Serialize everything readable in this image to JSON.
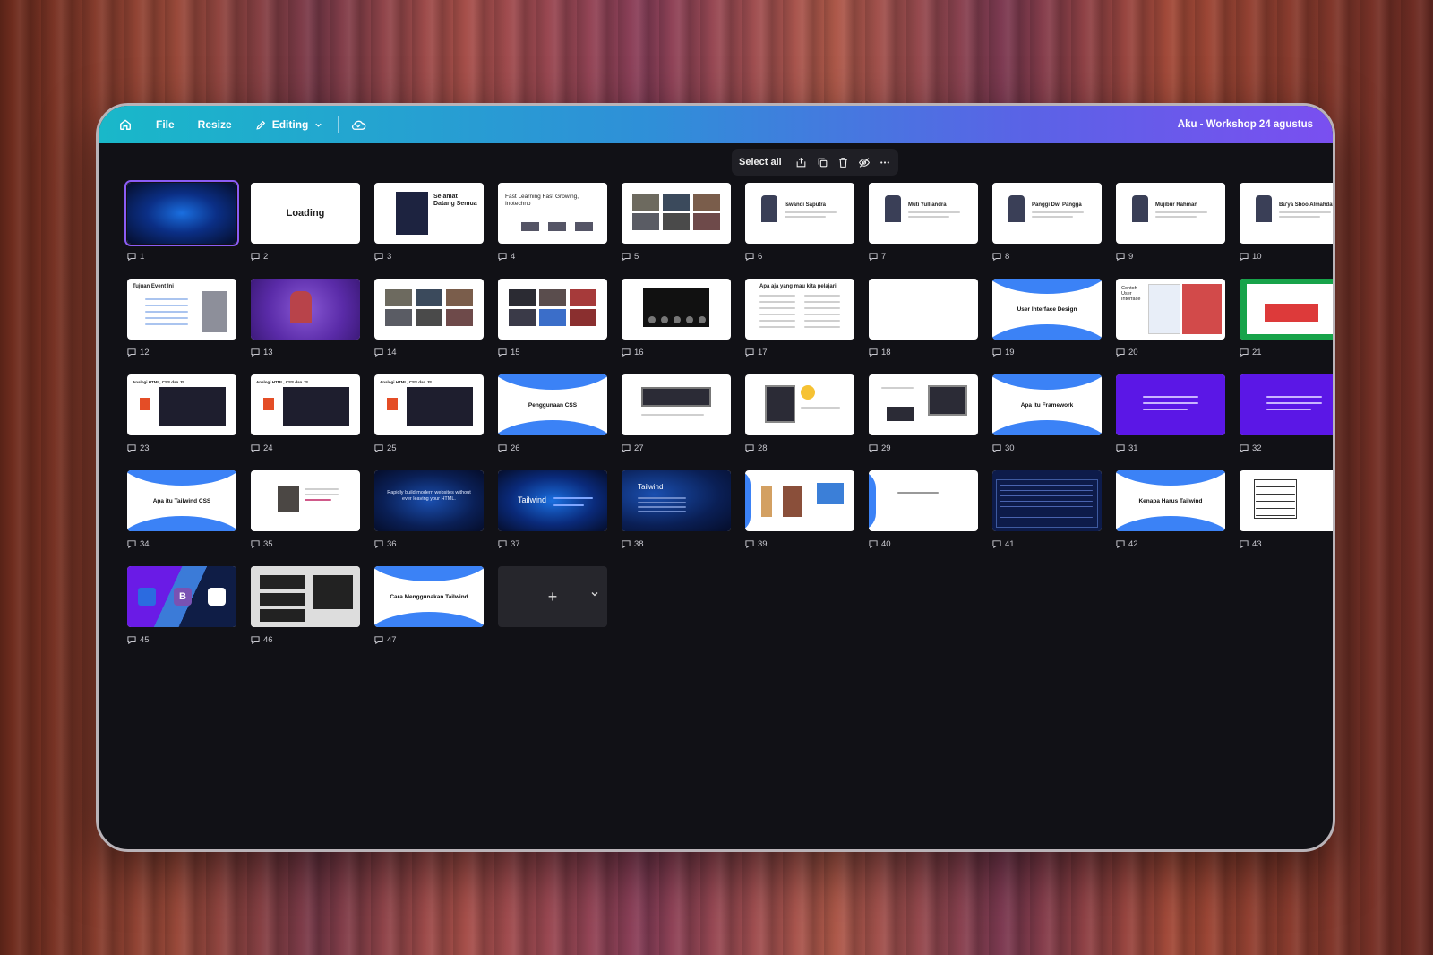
{
  "topbar": {
    "file": "File",
    "resize": "Resize",
    "editing": "Editing",
    "doc_title": "Aku - Workshop 24 agustus"
  },
  "selection_bar": {
    "select_all": "Select all"
  },
  "slides": [
    {
      "n": "1",
      "kind": "dark-blue",
      "selected": true
    },
    {
      "n": "2",
      "kind": "loading",
      "text": "Loading"
    },
    {
      "n": "3",
      "kind": "welcome",
      "text": "Selamat Datang Semua"
    },
    {
      "n": "4",
      "kind": "fastlearn",
      "text": "Fast Learning Fast Growing, Inotechno"
    },
    {
      "n": "5",
      "kind": "photos"
    },
    {
      "n": "6",
      "kind": "person",
      "text": "Iswandi Saputra"
    },
    {
      "n": "7",
      "kind": "person",
      "text": "Muti Yulliandra"
    },
    {
      "n": "8",
      "kind": "person",
      "text": "Panggi Dwi Pangga"
    },
    {
      "n": "9",
      "kind": "person",
      "text": "Mujibur Rahman"
    },
    {
      "n": "10",
      "kind": "person",
      "text": "Bu'ya Shoo Almahdaly"
    },
    {
      "n": "12",
      "kind": "list",
      "text": "Tujuan Event Ini"
    },
    {
      "n": "13",
      "kind": "purple-photo"
    },
    {
      "n": "14",
      "kind": "photos"
    },
    {
      "n": "15",
      "kind": "photos2"
    },
    {
      "n": "16",
      "kind": "screen"
    },
    {
      "n": "17",
      "kind": "text-list",
      "text": "Apa aja yang mau kita pelajari"
    },
    {
      "n": "18",
      "kind": "blank"
    },
    {
      "n": "19",
      "kind": "arc",
      "text": "User Interface Design"
    },
    {
      "n": "20",
      "kind": "contoh",
      "text": "Contoh User Interface"
    },
    {
      "n": "21",
      "kind": "green"
    },
    {
      "n": "23",
      "kind": "code",
      "text": "Analogi HTML, CSS dan JS"
    },
    {
      "n": "24",
      "kind": "code2",
      "text": "Analogi HTML, CSS dan JS"
    },
    {
      "n": "25",
      "kind": "code",
      "text": "Analogi HTML, CSS dan JS"
    },
    {
      "n": "26",
      "kind": "arc",
      "text": "Penggunaan CSS"
    },
    {
      "n": "27",
      "kind": "inline"
    },
    {
      "n": "28",
      "kind": "internal"
    },
    {
      "n": "29",
      "kind": "external"
    },
    {
      "n": "30",
      "kind": "arc",
      "text": "Apa itu Framework"
    },
    {
      "n": "31",
      "kind": "violet"
    },
    {
      "n": "32",
      "kind": "violet"
    },
    {
      "n": "34",
      "kind": "arc",
      "text": "Apa itu Tailwind CSS"
    },
    {
      "n": "35",
      "kind": "quote"
    },
    {
      "n": "36",
      "kind": "tw-dark",
      "text": "Rapidly build modern websites without ever leaving your HTML."
    },
    {
      "n": "37",
      "kind": "tw-dark2",
      "text": "Tailwind"
    },
    {
      "n": "38",
      "kind": "tw-dark3",
      "text": "Tailwind"
    },
    {
      "n": "39",
      "kind": "lego"
    },
    {
      "n": "40",
      "kind": "side-arc"
    },
    {
      "n": "41",
      "kind": "navy-table"
    },
    {
      "n": "42",
      "kind": "arc",
      "text": "Kenapa Harus Tailwind"
    },
    {
      "n": "43",
      "kind": "table"
    },
    {
      "n": "45",
      "kind": "logos"
    },
    {
      "n": "46",
      "kind": "code-grey"
    },
    {
      "n": "47",
      "kind": "arc",
      "text": "Cara Menggunakan Tailwind"
    }
  ]
}
